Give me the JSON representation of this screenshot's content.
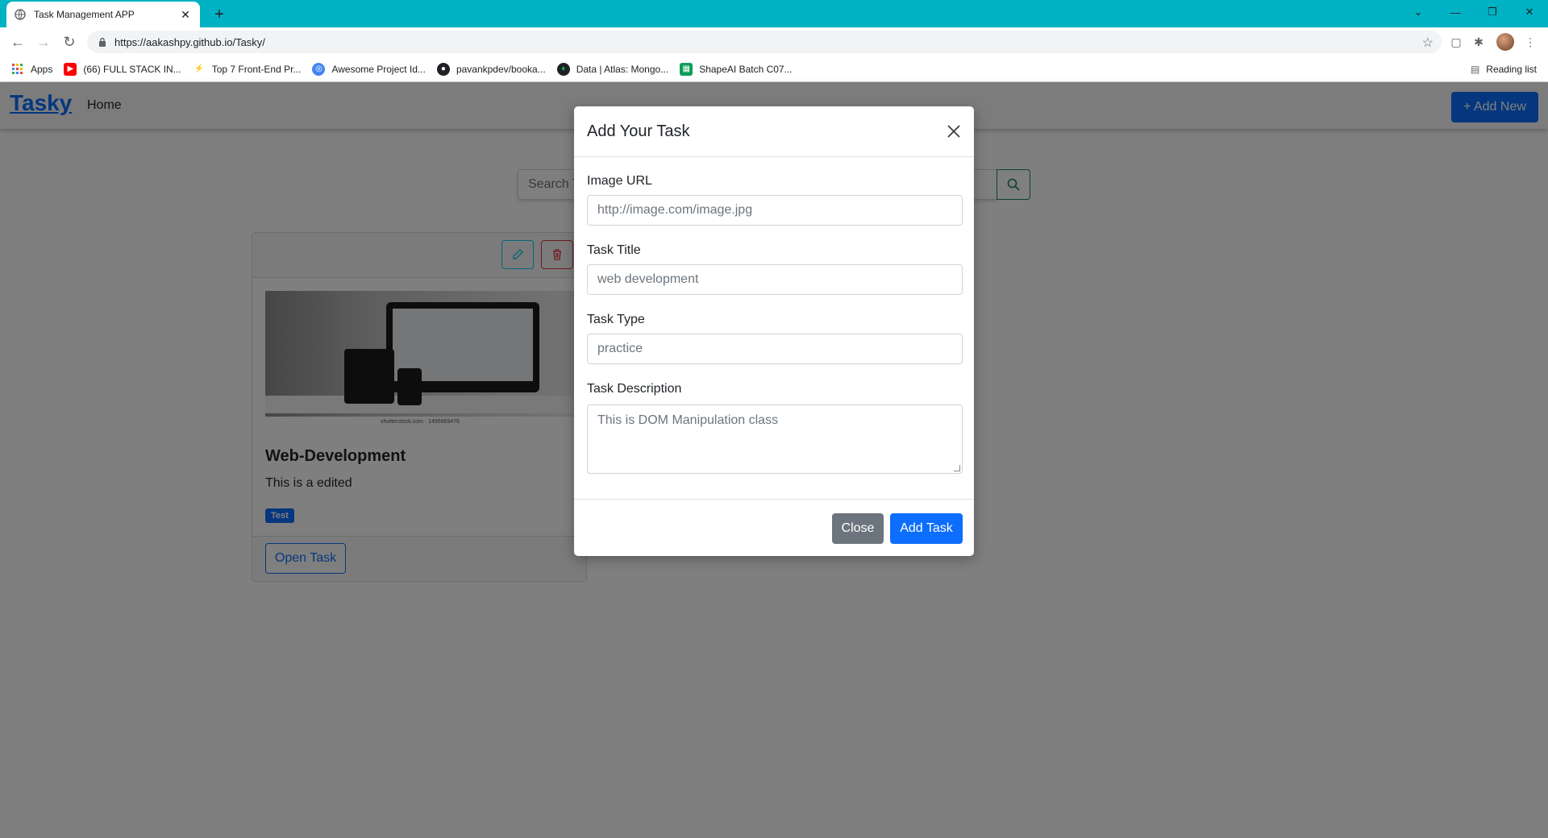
{
  "browser": {
    "tab_title": "Task Management APP",
    "url": "https://aakashpy.github.io/Tasky/",
    "bookmarks": [
      {
        "label": "Apps",
        "icon": "apps-grid-icon",
        "color": "#ea4335"
      },
      {
        "label": "(66) FULL STACK IN...",
        "icon": "youtube-icon",
        "color": "#ff0000"
      },
      {
        "label": "Top 7 Front-End Pr...",
        "icon": "bookmark-icon",
        "color": "#e53935"
      },
      {
        "label": "Awesome Project Id...",
        "icon": "globe-icon",
        "color": "#4285f4"
      },
      {
        "label": "pavankpdev/booka...",
        "icon": "github-icon",
        "color": "#202124"
      },
      {
        "label": "Data | Atlas: Mongo...",
        "icon": "mongodb-icon",
        "color": "#13aa52"
      },
      {
        "label": "ShapeAI Batch C07...",
        "icon": "sheets-icon",
        "color": "#0f9d58"
      }
    ],
    "reading_list": "Reading list"
  },
  "app": {
    "brand": "Tasky",
    "nav_home": "Home",
    "add_new": "+ Add New",
    "search_placeholder": "Search T"
  },
  "card": {
    "title": "Web-Development",
    "text": "This is a edited",
    "badge": "Test",
    "open_button": "Open Task",
    "image_credit": "shutterstock.com · 1495869476"
  },
  "modal": {
    "title": "Add Your Task",
    "image_url_label": "Image URL",
    "image_url_placeholder": "http://image.com/image.jpg",
    "task_title_label": "Task Title",
    "task_title_placeholder": "web development",
    "task_type_label": "Task Type",
    "task_type_placeholder": "practice",
    "task_description_label": "Task Description",
    "task_description_placeholder": "This is DOM Manipulation class",
    "close_button": "Close",
    "add_button": "Add Task"
  },
  "colors": {
    "primary": "#0d6efd",
    "secondary": "#6c757d",
    "tabbar": "#00b2c3"
  }
}
